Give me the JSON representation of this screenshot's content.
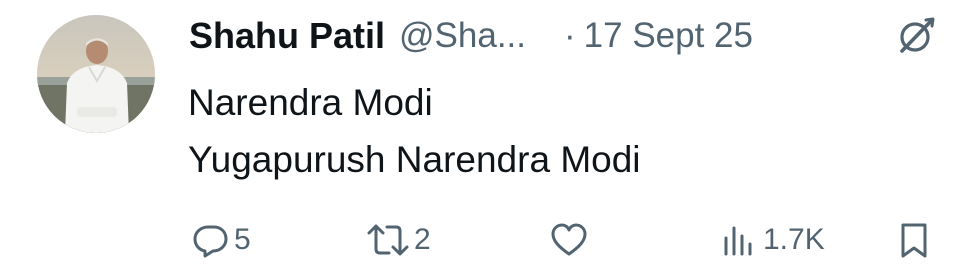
{
  "tweet": {
    "display_name": "Shahu Patil",
    "handle": "@Sha...",
    "separator": "·",
    "timestamp": "17 Sept 25",
    "avatar_icon": "profile-photo",
    "grok_icon": "grok-slash-icon",
    "text_lines": [
      "Narendra Modi",
      "Yugapurush Narendra Modi"
    ]
  },
  "actions": {
    "reply_count": "5",
    "repost_count": "2",
    "like_count": "",
    "views_count": "1.7K"
  },
  "colors": {
    "text_primary": "#0f1419",
    "text_secondary": "#536471",
    "background": "#ffffff"
  }
}
